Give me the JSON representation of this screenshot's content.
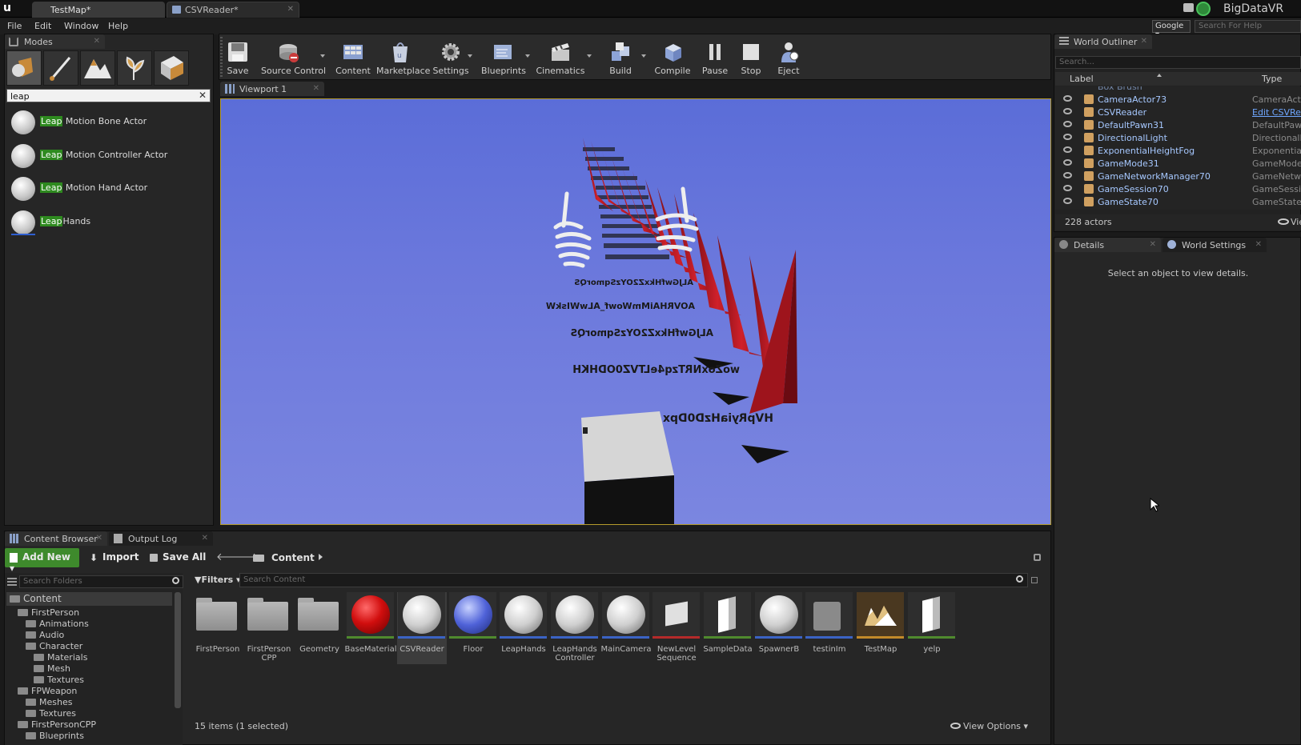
{
  "title_bar": {
    "tabs": [
      {
        "label": "TestMap*",
        "active": true
      },
      {
        "label": "CSVReader*",
        "active": false
      }
    ],
    "project_name": "BigDataVR",
    "search_engine": "Google",
    "help_placeholder": "Search For Help"
  },
  "menu": [
    "File",
    "Edit",
    "Window",
    "Help"
  ],
  "modes_panel": {
    "title": "Modes",
    "search_value": "leap",
    "results": [
      {
        "highlight": "Leap",
        "rest": " Motion Bone Actor"
      },
      {
        "highlight": "Leap",
        "rest": " Motion Controller Actor"
      },
      {
        "highlight": "Leap",
        "rest": " Motion Hand Actor"
      },
      {
        "highlight": "Leap",
        "rest": "Hands"
      }
    ]
  },
  "toolbar": [
    {
      "label": "Save",
      "icon": "save-icon"
    },
    {
      "label": "Source Control",
      "icon": "source-control-icon"
    },
    {
      "label": "Content",
      "icon": "content-icon"
    },
    {
      "label": "Marketplace",
      "icon": "marketplace-icon"
    },
    {
      "label": "Settings",
      "icon": "settings-icon"
    },
    {
      "label": "Blueprints",
      "icon": "blueprints-icon"
    },
    {
      "label": "Cinematics",
      "icon": "cinematics-icon"
    },
    {
      "label": "Build",
      "icon": "build-icon"
    },
    {
      "label": "Compile",
      "icon": "compile-icon"
    },
    {
      "label": "Pause",
      "icon": "pause-icon"
    },
    {
      "label": "Stop",
      "icon": "stop-icon"
    },
    {
      "label": "Eject",
      "icon": "eject-icon"
    }
  ],
  "viewport": {
    "tab_label": "Viewport 1",
    "labels": [
      "ALJGwfHkxZ2OYzSqmorQS",
      "AOVRHAiMmWowf_ALwWIskW",
      "ALJGwfHkxZ2OYzSqmorQS",
      "woZoxNRTzq4eLTVZ0ODHKH",
      "HVpRyiaHzD0Dpx"
    ]
  },
  "world_outliner": {
    "title": "World Outliner",
    "search_placeholder": "Search...",
    "col_label": "Label",
    "col_type": "Type",
    "rows": [
      {
        "label": "CameraActor73",
        "type": "CameraActor"
      },
      {
        "label": "CSVReader",
        "type": "Edit CSVReader"
      },
      {
        "label": "DefaultPawn31",
        "type": "DefaultPawn"
      },
      {
        "label": "DirectionalLight",
        "type": "DirectionalLight"
      },
      {
        "label": "ExponentialHeightFog",
        "type": "ExponentialHeightFog"
      },
      {
        "label": "GameMode31",
        "type": "GameMode"
      },
      {
        "label": "GameNetworkManager70",
        "type": "GameNetworkManager"
      },
      {
        "label": "GameSession70",
        "type": "GameSession"
      },
      {
        "label": "GameState70",
        "type": "GameState"
      }
    ],
    "actor_count": "228 actors",
    "view_options": "View Options"
  },
  "details": {
    "tab_details": "Details",
    "tab_world_settings": "World Settings",
    "empty_message": "Select an object to view details."
  },
  "content_browser": {
    "tab_label": "Content Browser",
    "output_tab": "Output Log",
    "add_new": "Add New",
    "import": "Import",
    "save_all": "Save All",
    "path_root": "Content",
    "search_folders_placeholder": "Search Folders",
    "filters": "Filters",
    "search_content_placeholder": "Search Content",
    "tree": [
      {
        "label": "Content",
        "level": 0
      },
      {
        "label": "FirstPerson",
        "level": 1
      },
      {
        "label": "Animations",
        "level": 2
      },
      {
        "label": "Audio",
        "level": 2
      },
      {
        "label": "Character",
        "level": 2
      },
      {
        "label": "Materials",
        "level": 3
      },
      {
        "label": "Mesh",
        "level": 3
      },
      {
        "label": "Textures",
        "level": 3
      },
      {
        "label": "FPWeapon",
        "level": 1
      },
      {
        "label": "Meshes",
        "level": 2
      },
      {
        "label": "Textures",
        "level": 2
      },
      {
        "label": "FirstPersonCPP",
        "level": 1
      },
      {
        "label": "Blueprints",
        "level": 2
      }
    ],
    "assets": [
      {
        "name": "FirstPerson",
        "kind": "folder"
      },
      {
        "name": "FirstPerson CPP",
        "kind": "folder"
      },
      {
        "name": "Geometry",
        "kind": "folder"
      },
      {
        "name": "BaseMaterial",
        "kind": "material"
      },
      {
        "name": "CSVReader",
        "kind": "blueprint"
      },
      {
        "name": "Floor",
        "kind": "material-blue"
      },
      {
        "name": "LeapHands",
        "kind": "blueprint"
      },
      {
        "name": "LeapHands Controller",
        "kind": "blueprint"
      },
      {
        "name": "MainCamera",
        "kind": "blueprint"
      },
      {
        "name": "NewLevel Sequence",
        "kind": "sequence"
      },
      {
        "name": "SampleData",
        "kind": "data"
      },
      {
        "name": "SpawnerB",
        "kind": "blueprint"
      },
      {
        "name": "testinIm",
        "kind": "struct"
      },
      {
        "name": "TestMap",
        "kind": "map"
      },
      {
        "name": "yelp",
        "kind": "data"
      }
    ],
    "status": "15 items (1 selected)",
    "view_options": "View Options"
  }
}
